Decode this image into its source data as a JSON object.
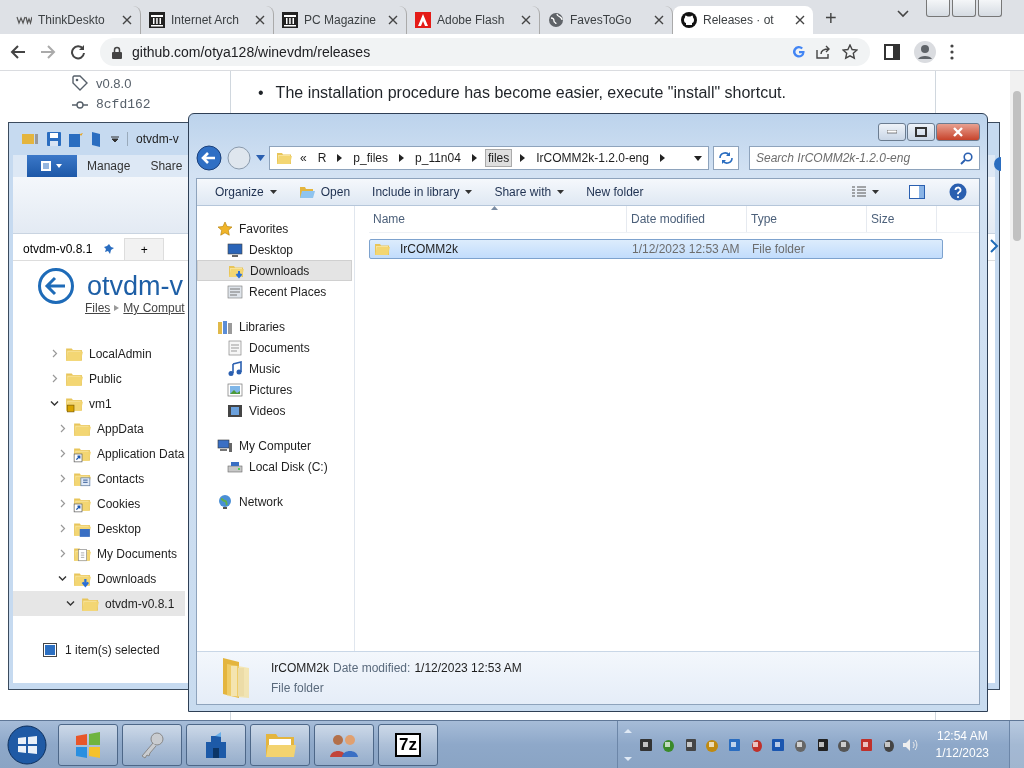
{
  "browser": {
    "tabs": [
      {
        "title": "ThinkDeskto",
        "kind": "letters",
        "selected": false
      },
      {
        "title": "Internet Arch",
        "kind": "archive",
        "selected": false
      },
      {
        "title": "PC Magazine",
        "kind": "archive",
        "selected": false
      },
      {
        "title": "Adobe Flash",
        "kind": "adobe",
        "selected": false
      },
      {
        "title": "FavesToGo",
        "kind": "globe",
        "selected": false
      },
      {
        "title": "Releases · ot",
        "kind": "github",
        "selected": true
      }
    ],
    "new_tab": "+",
    "address": "github.com/otya128/winevdm/releases"
  },
  "page": {
    "tag": "v0.8.0",
    "commit": "8cfd162",
    "bullets": [
      {
        "marker": "•",
        "text": "The installation procedure has become easier, execute \"install\" shortcut."
      }
    ]
  },
  "back_window": {
    "title": "otvdm-v",
    "ribbon_tabs": [
      "Manage",
      "Share"
    ],
    "tabs": [
      {
        "label": "otvdm-v0.8.1",
        "selected": true
      },
      {
        "label": "+",
        "selected": false
      }
    ],
    "heading": "otvdm-v",
    "breadcrumb": [
      "Files",
      "My Comput"
    ],
    "tree": [
      {
        "label": "LocalAdmin",
        "kind": "folder",
        "expanded": false,
        "selected": false
      },
      {
        "label": "Public",
        "kind": "folder",
        "expanded": false,
        "selected": false
      },
      {
        "label": "vm1",
        "kind": "locked",
        "expanded": true,
        "selected": false,
        "children": [
          {
            "label": "AppData",
            "kind": "folder",
            "expanded": false,
            "selected": false
          },
          {
            "label": "Application Data",
            "kind": "shortcut",
            "expanded": false,
            "selected": false
          },
          {
            "label": "Contacts",
            "kind": "contacts",
            "expanded": false,
            "selected": false
          },
          {
            "label": "Cookies",
            "kind": "shortcut",
            "expanded": false,
            "selected": false
          },
          {
            "label": "Desktop",
            "kind": "desktop",
            "expanded": false,
            "selected": false
          },
          {
            "label": "My Documents",
            "kind": "documents",
            "expanded": false,
            "selected": false
          },
          {
            "label": "Downloads",
            "kind": "downloads",
            "expanded": true,
            "selected": false,
            "children": [
              {
                "label": "otvdm-v0.8.1",
                "kind": "folder",
                "expanded": true,
                "selected": true
              }
            ]
          }
        ]
      }
    ],
    "status": "1 item(s) selected"
  },
  "explorer": {
    "overflow": "«",
    "breadcrumb": [
      {
        "label": "R",
        "hovered": false
      },
      {
        "label": "p_files",
        "hovered": false
      },
      {
        "label": "p_11n04",
        "hovered": false
      },
      {
        "label": "files",
        "hovered": true
      },
      {
        "label": "IrCOMM2k-1.2.0-eng",
        "hovered": false
      }
    ],
    "search": {
      "placeholder": "Search IrCOMM2k-1.2.0-eng"
    },
    "toolbar": [
      {
        "label": "Organize",
        "kind": "menu"
      },
      {
        "label": "Open",
        "kind": "open"
      },
      {
        "label": "Include in library",
        "kind": "menu"
      },
      {
        "label": "Share with",
        "kind": "menu"
      },
      {
        "label": "New folder",
        "kind": "plain"
      }
    ],
    "nav": [
      {
        "label": "Favorites",
        "kind": "favorites",
        "children": [
          {
            "label": "Desktop",
            "kind": "desktop",
            "selected": false
          },
          {
            "label": "Downloads",
            "kind": "downloads",
            "selected": true
          },
          {
            "label": "Recent Places",
            "kind": "recent",
            "selected": false
          }
        ]
      },
      {
        "label": "Libraries",
        "kind": "libraries",
        "children": [
          {
            "label": "Documents",
            "kind": "documents",
            "selected": false
          },
          {
            "label": "Music",
            "kind": "music",
            "selected": false
          },
          {
            "label": "Pictures",
            "kind": "pictures",
            "selected": false
          },
          {
            "label": "Videos",
            "kind": "videos",
            "selected": false
          }
        ]
      },
      {
        "label": "My Computer",
        "kind": "computer",
        "children": [
          {
            "label": "Local Disk (C:)",
            "kind": "disk",
            "selected": false
          }
        ]
      },
      {
        "label": "Network",
        "kind": "network"
      }
    ],
    "columns": [
      "Name",
      "Date modified",
      "Type",
      "Size"
    ],
    "rows": [
      {
        "name": "IrCOMM2k",
        "date": "1/12/2023 12:53 AM",
        "type": "File folder",
        "selected": true
      }
    ],
    "details": {
      "name": "IrCOMM2k",
      "date_label": "Date modified:",
      "date": "1/12/2023 12:53 AM",
      "type": "File folder"
    }
  },
  "taskbar": {
    "apps": [
      {
        "kind": "flag"
      },
      {
        "kind": "key"
      },
      {
        "kind": "tower"
      },
      {
        "kind": "folder"
      },
      {
        "kind": "people"
      },
      {
        "kind": "text",
        "label": "7z"
      }
    ],
    "clock": {
      "time": "12:54 AM",
      "date": "1/12/2023"
    }
  }
}
